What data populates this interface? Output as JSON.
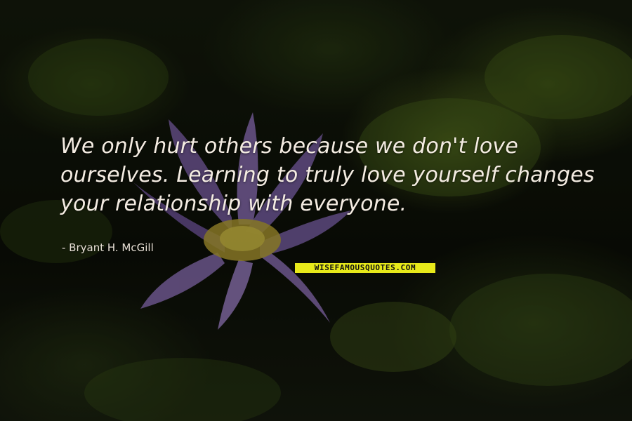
{
  "quote": {
    "lines": [
      "We only hurt others because we don't love",
      "ourselves. Learning to truly love yourself changes",
      "your relationship with everyone."
    ],
    "author": "- Bryant H. McGill"
  },
  "watermark": "WISEFAMOUSQUOTES.COM",
  "colors": {
    "text": "#f4ece2",
    "flower": "#8a6fb0",
    "flower_center": "#d8c23a",
    "leaf": "#6f8a2a",
    "watermark_bg": "#e7e91a"
  }
}
